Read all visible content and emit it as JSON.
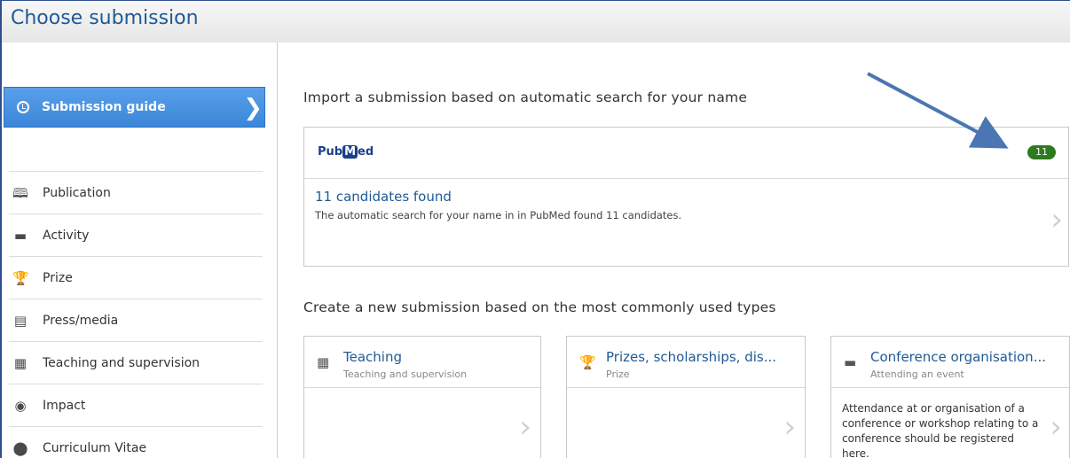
{
  "window": {
    "title": "Choose submission"
  },
  "sidebar": {
    "guide_label": "Submission guide",
    "items": [
      {
        "label": "Publication",
        "icon": "book-icon"
      },
      {
        "label": "Activity",
        "icon": "briefcase-icon"
      },
      {
        "label": "Prize",
        "icon": "trophy-icon"
      },
      {
        "label": "Press/media",
        "icon": "newspaper-icon"
      },
      {
        "label": "Teaching and supervision",
        "icon": "film-icon"
      },
      {
        "label": "Impact",
        "icon": "target-icon"
      },
      {
        "label": "Curriculum Vitae",
        "icon": "cv-icon"
      }
    ]
  },
  "import_section": {
    "title": "Import a submission based on automatic search for your name",
    "source_logo": {
      "prefix": "Pub",
      "mid": "M",
      "suffix": "ed"
    },
    "badge_count": "11",
    "candidates_title": "11 candidates found",
    "candidates_desc": "The automatic search for your name in in PubMed found 11 candidates."
  },
  "create_section": {
    "title": "Create a new submission based on the most commonly used types",
    "cards": [
      {
        "title": "Teaching",
        "subtitle": "Teaching and supervision",
        "description": "",
        "icon": "film-icon"
      },
      {
        "title": "Prizes, scholarships, dis...",
        "subtitle": "Prize",
        "description": "",
        "icon": "trophy-icon"
      },
      {
        "title": "Conference organisation...",
        "subtitle": "Attending an event",
        "description": "Attendance at or organisation of a conference or workshop relating to a conference should be registered here.",
        "icon": "briefcase-icon"
      }
    ]
  },
  "colors": {
    "accent": "#3a86d8",
    "link": "#1f5a96",
    "badge": "#2e7a1e"
  }
}
